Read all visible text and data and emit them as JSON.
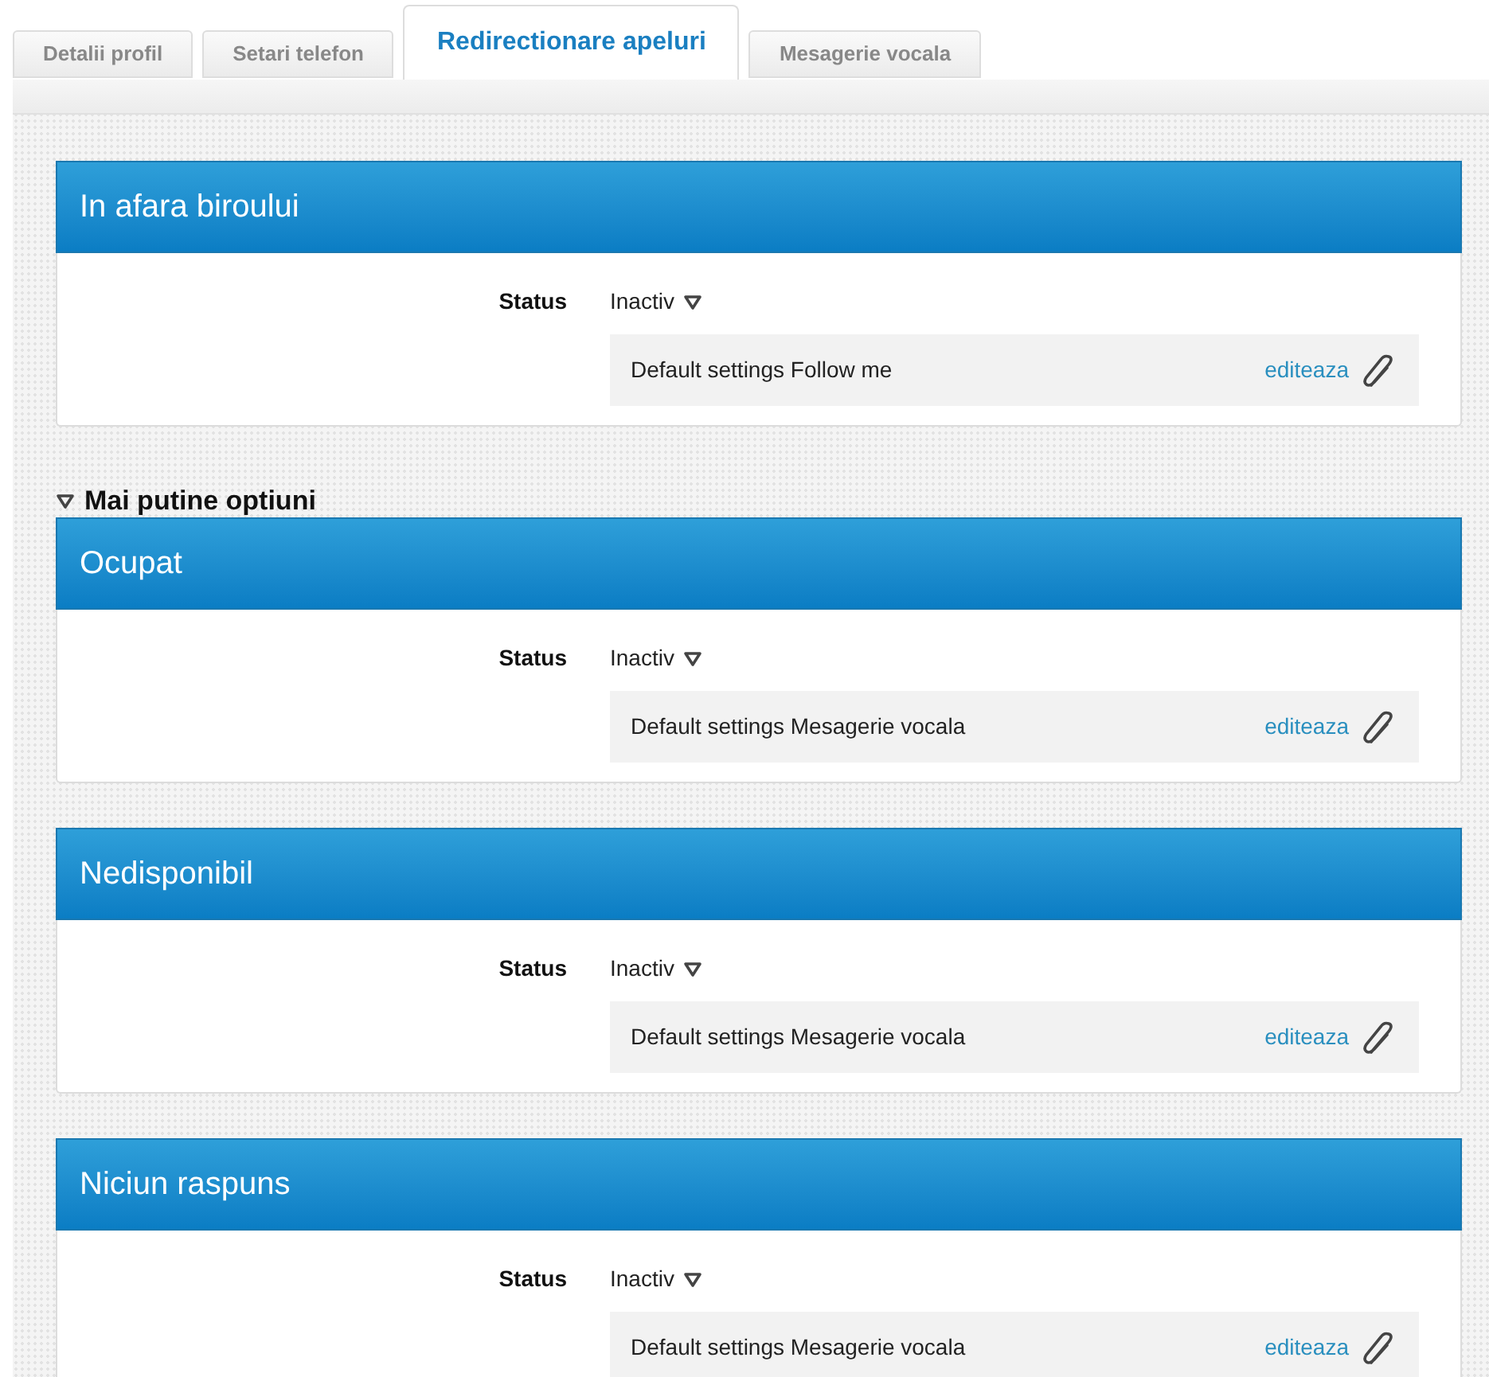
{
  "tabs": [
    {
      "label": "Detalii profil",
      "selected": false
    },
    {
      "label": "Setari telefon",
      "selected": false
    },
    {
      "label": "Redirectionare apeluri",
      "selected": true
    },
    {
      "label": "Mesagerie vocala",
      "selected": false
    }
  ],
  "primary_section": {
    "title": "In afara biroului",
    "status_label": "Status",
    "status": "Inactiv",
    "setting": "Default settings Follow me",
    "edit_link": "editeaza"
  },
  "more_options": {
    "label": "Mai putine optiuni",
    "expanded": true
  },
  "sections": [
    {
      "title": "Ocupat",
      "status_label": "Status",
      "status": "Inactiv",
      "setting": "Default settings Mesagerie vocala",
      "edit_link": "editeaza"
    },
    {
      "title": "Nedisponibil",
      "status_label": "Status",
      "status": "Inactiv",
      "setting": "Default settings Mesagerie vocala",
      "edit_link": "editeaza"
    },
    {
      "title": "Niciun raspuns",
      "status_label": "Status",
      "status": "Inactiv",
      "setting": "Default settings Mesagerie vocala",
      "edit_link": "editeaza"
    }
  ]
}
